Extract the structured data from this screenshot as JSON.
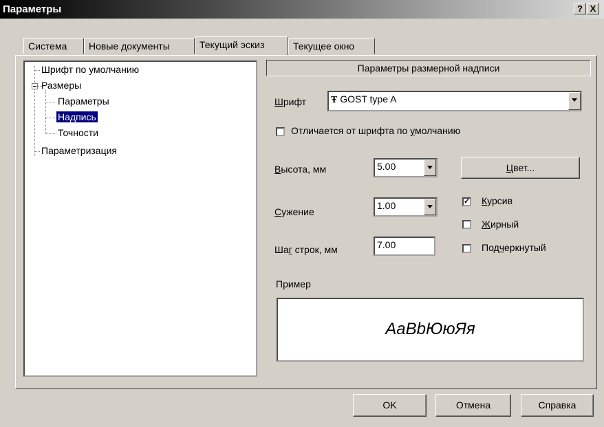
{
  "window": {
    "title": "Параметры",
    "help_button": "?",
    "close_button": "X"
  },
  "tabs": [
    {
      "label": "Система"
    },
    {
      "label": "Новые документы"
    },
    {
      "label": "Текущий эскиз"
    },
    {
      "label": "Текущее окно"
    }
  ],
  "active_tab": "Текущий эскиз",
  "tree": {
    "items": [
      {
        "label": "Шрифт по умолчанию"
      },
      {
        "label": "Размеры"
      },
      {
        "label": "Параметры"
      },
      {
        "label": "Надпись"
      },
      {
        "label": "Точности"
      },
      {
        "label": "Параметризация"
      }
    ],
    "selected": "Надпись"
  },
  "section": {
    "title": "Параметры размерной надписи"
  },
  "font": {
    "label_first": "Ш",
    "label_rest": "рифт",
    "value": "GOST type A",
    "glyph": "Ŧ"
  },
  "differs": {
    "label_pre": "Отличается от шрифта по ",
    "label_u": "у",
    "label_post": "молчанию",
    "checked": false
  },
  "height": {
    "label_first": "В",
    "label_rest": "ысота, мм",
    "value": "5.00"
  },
  "narrowing": {
    "label_first": "С",
    "label_rest": "ужение",
    "value": "1.00"
  },
  "line_step": {
    "label_pre": "Ша",
    "label_u": "г",
    "label_post": " строк, мм",
    "value": "7.00"
  },
  "color_button": {
    "label_first": "Ц",
    "label_rest": "вет..."
  },
  "italic": {
    "label_first": "К",
    "label_rest": "урсив",
    "checked": true,
    "mark": "✓"
  },
  "bold": {
    "label_first": "Ж",
    "label_rest": "ирный",
    "checked": false
  },
  "underline": {
    "label_pre": "Под",
    "label_u": "ч",
    "label_post": "еркнутый",
    "checked": false
  },
  "example": {
    "label": "Пример",
    "text": "АаВbЮюЯя"
  },
  "buttons": {
    "ok": "OK",
    "cancel": "Отмена",
    "help": "Справка"
  }
}
